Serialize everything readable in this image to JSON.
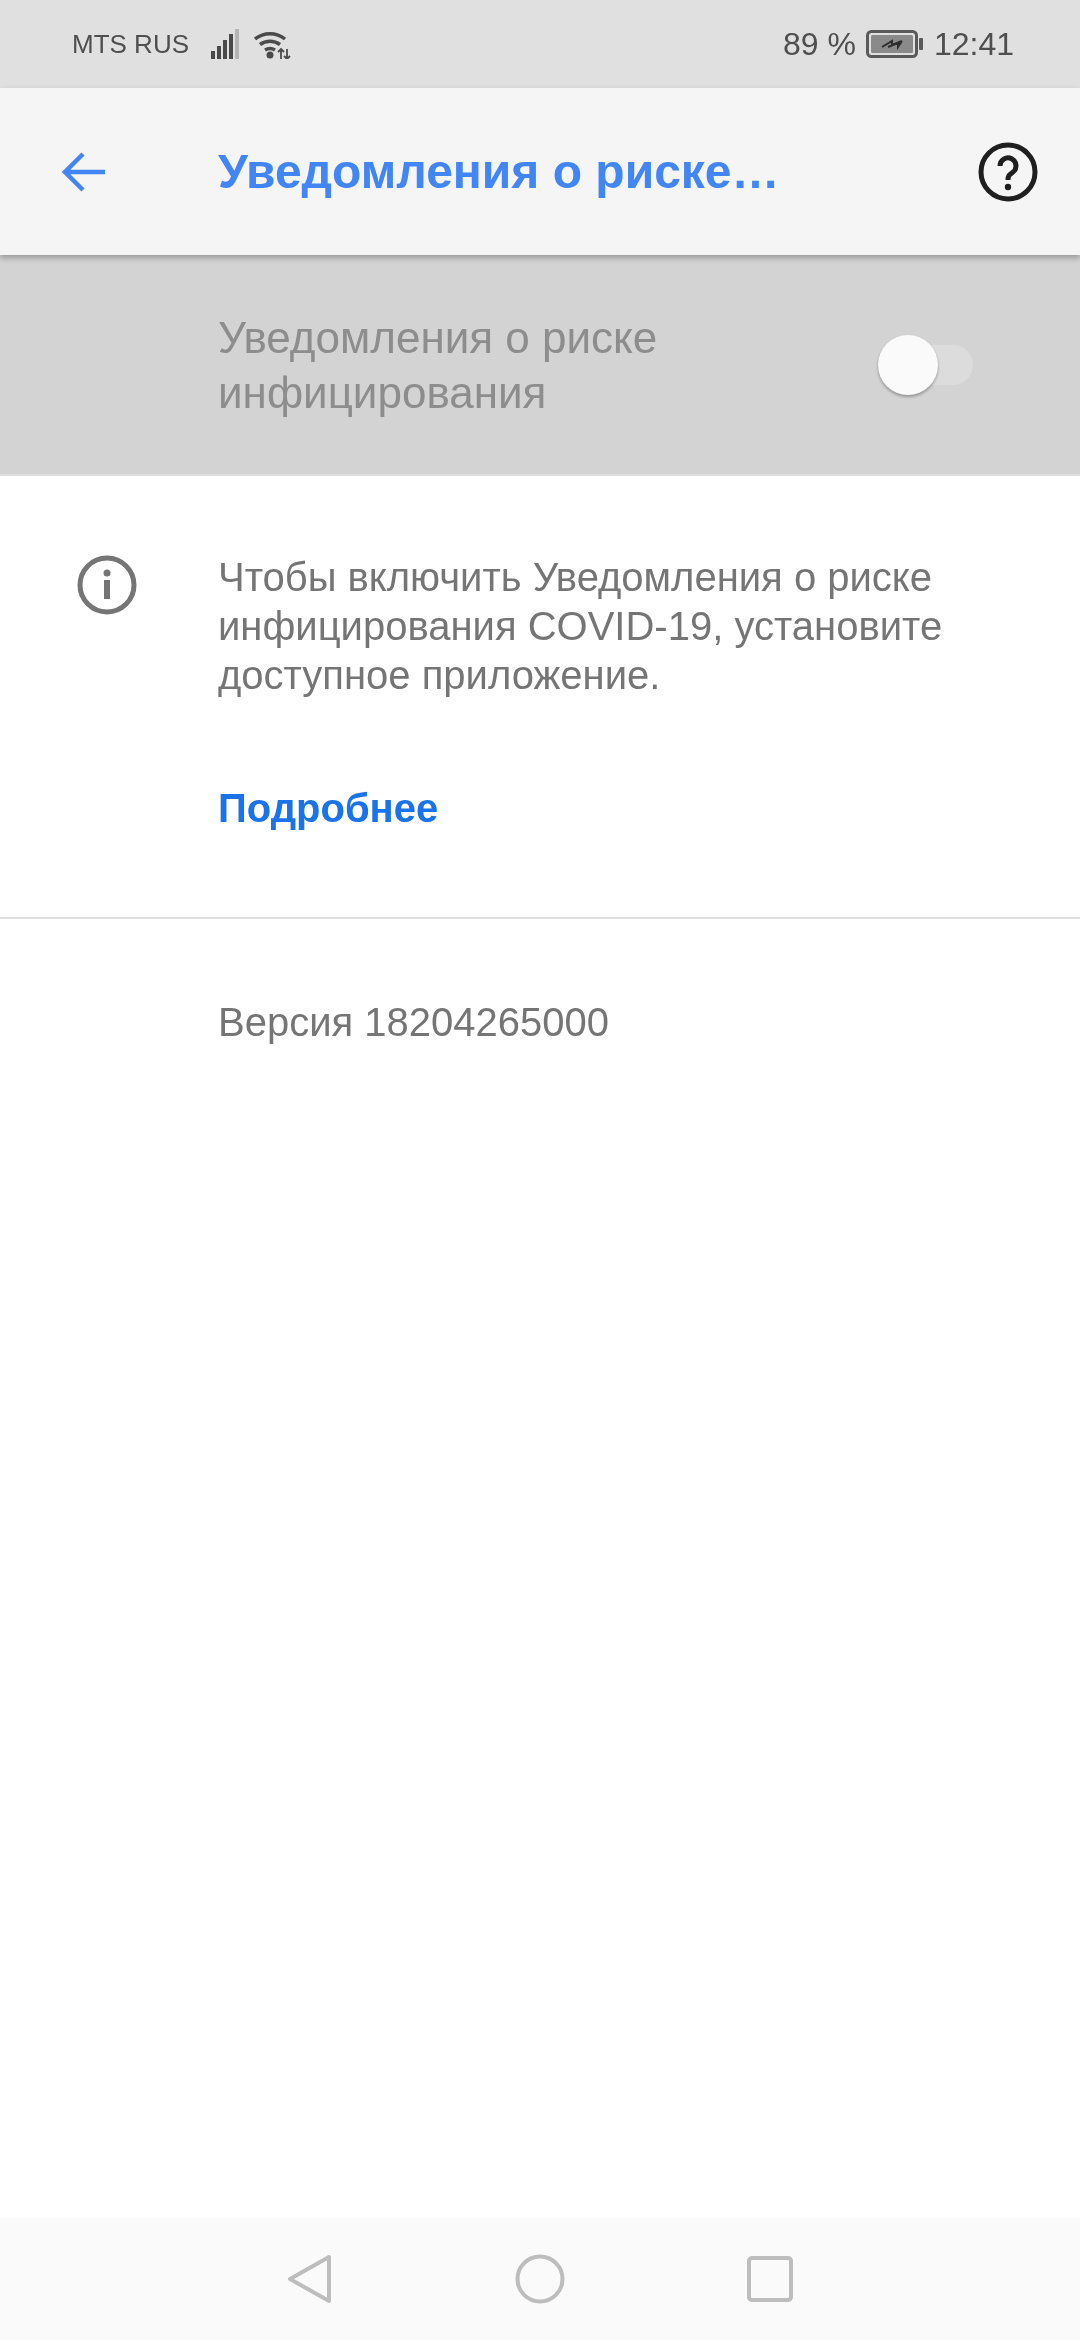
{
  "status_bar": {
    "carrier": "MTS RUS",
    "battery": "89 %",
    "time": "12:41"
  },
  "app_bar": {
    "title": "Уведомления о риске…"
  },
  "master_switch": {
    "label": "Уведомления о риске инфицирования",
    "on": false,
    "disabled": true
  },
  "info": {
    "text": "Чтобы включить Уведомления о риске инфицирования COVID-19, установите доступное приложение.",
    "link": "Подробнее"
  },
  "version": "Версия 18204265000"
}
